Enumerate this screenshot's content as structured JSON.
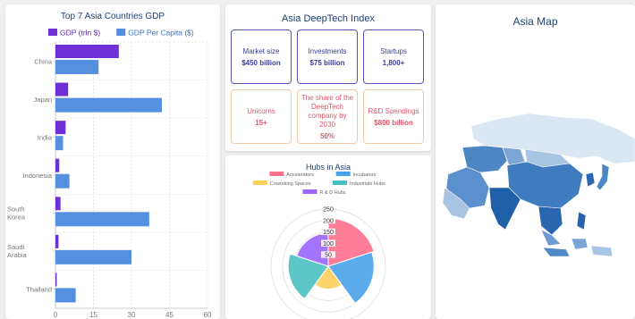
{
  "gdp_panel": {
    "title": "Top 7 Asia Countries GDP",
    "legend": [
      {
        "label": "GDP (trln $)",
        "color": "#6f2fd6"
      },
      {
        "label": "GDP Per Capita ($)",
        "color": "#5590e0"
      }
    ]
  },
  "chart_data": [
    {
      "type": "bar",
      "orientation": "horizontal",
      "title": "Top 7 Asia Countries GDP",
      "categories": [
        "China",
        "Japan",
        "India",
        "Indonesia",
        "South Korea",
        "Saudi Arabia",
        "Thailand"
      ],
      "series": [
        {
          "name": "GDP (trln $)",
          "values": [
            25,
            5,
            4,
            1.5,
            2,
            1.2,
            0.5
          ]
        },
        {
          "name": "GDP Per Capita ($)",
          "values": [
            17,
            42,
            3,
            5.5,
            37,
            30,
            8
          ]
        }
      ],
      "xlim": [
        0,
        60
      ],
      "xticks": [
        0,
        15,
        30,
        45,
        60
      ],
      "grid": true,
      "legend": "top"
    },
    {
      "type": "polar-area",
      "title": "Hubs in Asia",
      "categories": [
        "Accelerators",
        "Incubators",
        "Coworking Spaces",
        "Industriale Hubs",
        "R & D Hubs"
      ],
      "values": [
        210,
        200,
        100,
        175,
        145
      ],
      "rticks": [
        50,
        100,
        150,
        200,
        250
      ],
      "rlim": [
        0,
        250
      ],
      "legend": "top"
    }
  ],
  "index_panel": {
    "title": "Asia DeepTech Index",
    "cards": [
      {
        "label": "Market size",
        "value": "$450 billion"
      },
      {
        "label": "Investments",
        "value": "$75 billion"
      },
      {
        "label": "Startups",
        "value": "1,800+"
      },
      {
        "label": "Unicorns",
        "value": "15+"
      },
      {
        "label": "The share of the DeepTech company by 2030",
        "value": "50%"
      },
      {
        "label": "R&D Spendings",
        "value": "$800 billion"
      }
    ]
  },
  "hubs_panel": {
    "title": "Hubs in Asia",
    "legend": [
      {
        "label": "Accelerators",
        "color": "#ff6f8c"
      },
      {
        "label": "Incubators",
        "color": "#4aa3eb"
      },
      {
        "label": "Coworking Spaces",
        "color": "#ffcf5a"
      },
      {
        "label": "Industriale Hubs",
        "color": "#4bc0c0"
      },
      {
        "label": "R & D Hubs",
        "color": "#9966ff"
      }
    ]
  },
  "map_panel": {
    "title": "Asia Map"
  },
  "colors": {
    "gdp": "#6f2fd6",
    "gdp_per_capita": "#5590e0",
    "title": "#1f3f73"
  }
}
